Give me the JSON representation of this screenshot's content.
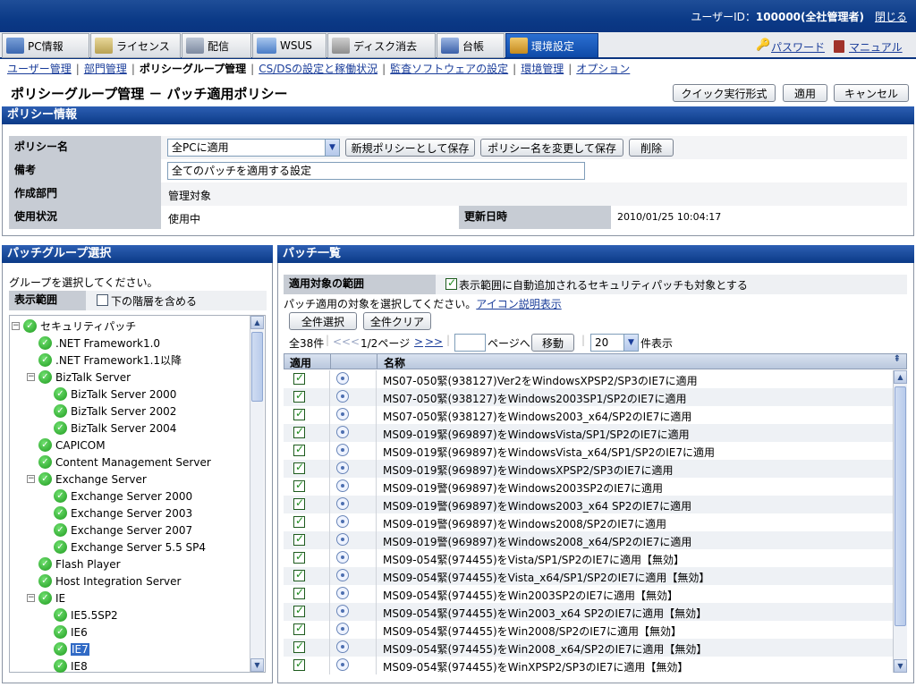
{
  "header": {
    "user_label": "ユーザーID：",
    "user_value": "100000(全社管理者)",
    "logout": "閉じる"
  },
  "tabs": [
    {
      "label": "PC情報"
    },
    {
      "label": "ライセンス"
    },
    {
      "label": "配信"
    },
    {
      "label": "WSUS",
      "badge": "WSUS"
    },
    {
      "label": "ディスク消去"
    },
    {
      "label": "台帳"
    },
    {
      "label": "環境設定"
    }
  ],
  "top_links": {
    "password": "パスワード",
    "manual": "マニュアル"
  },
  "subnav": [
    {
      "label": "ユーザー管理",
      "current": false
    },
    {
      "label": "部門管理",
      "current": false
    },
    {
      "label": "ポリシーグループ管理",
      "current": true
    },
    {
      "label": "CS/DSの設定と稼働状況",
      "current": false
    },
    {
      "label": "監査ソフトウェアの設定",
      "current": false
    },
    {
      "label": "環境管理",
      "current": false
    },
    {
      "label": "オプション",
      "current": false
    }
  ],
  "page_title": "ポリシーグループ管理 － パッチ適用ポリシー",
  "toolbar": {
    "quick": "クイック実行形式",
    "apply": "適用",
    "cancel": "キャンセル"
  },
  "policy_info": {
    "section_title": "ポリシー情報",
    "name_label": "ポリシー名",
    "name_value": "全PCに適用",
    "btn_save_new": "新規ポリシーとして保存",
    "btn_rename": "ポリシー名を変更して保存",
    "btn_delete": "削除",
    "note_label": "備考",
    "note_value": "全てのパッチを適用する設定",
    "dept_label": "作成部門",
    "dept_value": "管理対象",
    "status_label": "使用状況",
    "status_value": "使用中",
    "updated_label": "更新日時",
    "updated_value": "2010/01/25 10:04:17"
  },
  "group_panel": {
    "title": "パッチグループ選択",
    "instruction": "グループを選択してください。",
    "scope_label": "表示範囲",
    "include_sub": "下の階層を含める",
    "tree": [
      {
        "label": "セキュリティパッチ",
        "level": 0,
        "expandable": true
      },
      {
        "label": ".NET Framework1.0",
        "level": 1,
        "expandable": false
      },
      {
        "label": ".NET Framework1.1以降",
        "level": 1,
        "expandable": false
      },
      {
        "label": "BizTalk Server",
        "level": 1,
        "expandable": true
      },
      {
        "label": "BizTalk Server 2000",
        "level": 2,
        "expandable": false
      },
      {
        "label": "BizTalk Server 2002",
        "level": 2,
        "expandable": false
      },
      {
        "label": "BizTalk Server 2004",
        "level": 2,
        "expandable": false
      },
      {
        "label": "CAPICOM",
        "level": 1,
        "expandable": false
      },
      {
        "label": "Content Management Server",
        "level": 1,
        "expandable": false
      },
      {
        "label": "Exchange Server",
        "level": 1,
        "expandable": true
      },
      {
        "label": "Exchange Server 2000",
        "level": 2,
        "expandable": false
      },
      {
        "label": "Exchange Server 2003",
        "level": 2,
        "expandable": false
      },
      {
        "label": "Exchange Server 2007",
        "level": 2,
        "expandable": false
      },
      {
        "label": "Exchange Server 5.5 SP4",
        "level": 2,
        "expandable": false
      },
      {
        "label": "Flash Player",
        "level": 1,
        "expandable": false
      },
      {
        "label": "Host Integration Server",
        "level": 1,
        "expandable": false
      },
      {
        "label": "IE",
        "level": 1,
        "expandable": true
      },
      {
        "label": "IE5.5SP2",
        "level": 2,
        "expandable": false
      },
      {
        "label": "IE6",
        "level": 2,
        "expandable": false
      },
      {
        "label": "IE7",
        "level": 2,
        "expandable": false,
        "selected": true
      },
      {
        "label": "IE8",
        "level": 2,
        "expandable": false
      }
    ]
  },
  "patch_panel": {
    "title": "パッチ一覧",
    "scope_label": "適用対象の範囲",
    "auto_add": "表示範囲に自動追加されるセキュリティパッチも対象とする",
    "instruction": "パッチ適用の対象を選択してください。",
    "icon_help": "アイコン説明表示",
    "select_all": "全件選択",
    "clear_all": "全件クリア",
    "count": "全38件",
    "first": "<<",
    "prev": "<",
    "page_info": "1/2ページ",
    "next": ">",
    "last": ">>",
    "goto_suffix": "ページへ",
    "move": "移動",
    "per_page": "20",
    "per_page_suffix": "件表示",
    "col_apply": "適用",
    "col_name": "名称",
    "rows": [
      "MS07-050緊(938127)Ver2をWindowsXPSP2/SP3のIE7に適用",
      "MS07-050緊(938127)をWindows2003SP1/SP2のIE7に適用",
      "MS07-050緊(938127)をWindows2003_x64/SP2のIE7に適用",
      "MS09-019緊(969897)をWindowsVista/SP1/SP2のIE7に適用",
      "MS09-019緊(969897)をWindowsVista_x64/SP1/SP2のIE7に適用",
      "MS09-019緊(969897)をWindowsXPSP2/SP3のIE7に適用",
      "MS09-019警(969897)をWindows2003SP2のIE7に適用",
      "MS09-019警(969897)をWindows2003_x64 SP2のIE7に適用",
      "MS09-019警(969897)をWindows2008/SP2のIE7に適用",
      "MS09-019警(969897)をWindows2008_x64/SP2のIE7に適用",
      "MS09-054緊(974455)をVista/SP1/SP2のIE7に適用【無効】",
      "MS09-054緊(974455)をVista_x64/SP1/SP2のIE7に適用【無効】",
      "MS09-054緊(974455)をWin2003SP2のIE7に適用【無効】",
      "MS09-054緊(974455)をWin2003_x64 SP2のIE7に適用【無効】",
      "MS09-054緊(974455)をWin2008/SP2のIE7に適用【無効】",
      "MS09-054緊(974455)をWin2008_x64/SP2のIE7に適用【無効】",
      "MS09-054緊(974455)をWinXPSP2/SP3のIE7に適用【無効】"
    ]
  },
  "colors": {
    "header_blue": "#0b3a87",
    "label_gray": "#c7ccd4",
    "link": "#1a3d9a",
    "check_green": "#1c8a1c"
  }
}
